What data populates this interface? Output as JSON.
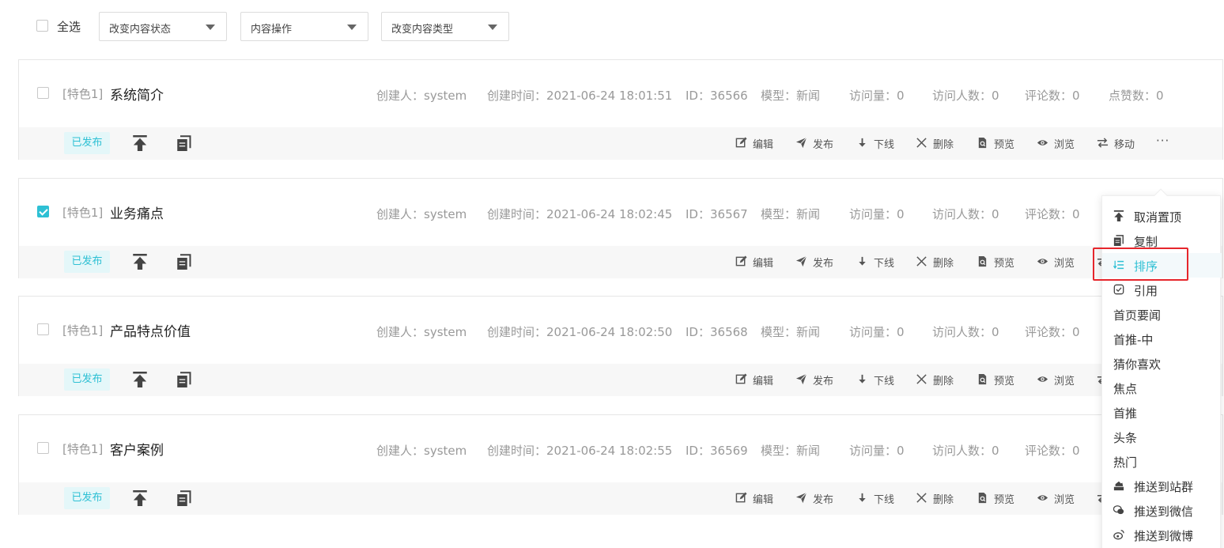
{
  "toolbar": {
    "select_all": "全选",
    "dropdowns": [
      "改变内容状态",
      "内容操作",
      "改变内容类型"
    ]
  },
  "labels": {
    "creator": "创建人：",
    "created_at": "创建时间：",
    "id": "ID：",
    "model": "模型：",
    "visits": "访问量：",
    "visitors": "访问人数：",
    "comments": "评论数：",
    "likes": "点赞数："
  },
  "actions": [
    "编辑",
    "发布",
    "下线",
    "删除",
    "预览",
    "浏览",
    "移动"
  ],
  "more": "···",
  "rows": [
    {
      "checked": false,
      "tag": "[特色1]",
      "title": "系统简介",
      "creator": "system",
      "created_at": "2021-06-24 18:01:51",
      "id": "36566",
      "model": "新闻",
      "visits": "0",
      "visitors": "0",
      "comments": "0",
      "likes": "0",
      "status": "已发布"
    },
    {
      "checked": true,
      "tag": "[特色1]",
      "title": "业务痛点",
      "creator": "system",
      "created_at": "2021-06-24 18:02:45",
      "id": "36567",
      "model": "新闻",
      "visits": "0",
      "visitors": "0",
      "comments": "0",
      "status": "已发布"
    },
    {
      "checked": false,
      "tag": "[特色1]",
      "title": "产品特点价值",
      "creator": "system",
      "created_at": "2021-06-24 18:02:50",
      "id": "36568",
      "model": "新闻",
      "visits": "0",
      "visitors": "0",
      "comments": "0",
      "status": "已发布"
    },
    {
      "checked": false,
      "tag": "[特色1]",
      "title": "客户案例",
      "creator": "system",
      "created_at": "2021-06-24 18:02:55",
      "id": "36569",
      "model": "新闻",
      "visits": "0",
      "visitors": "0",
      "comments": "0",
      "status": "已发布"
    }
  ],
  "menu": {
    "items": [
      {
        "label": "取消置顶",
        "icon": "arrow-up-icon"
      },
      {
        "label": "复制",
        "icon": "copy-icon"
      },
      {
        "label": "排序",
        "icon": "sort-icon",
        "active": true
      },
      {
        "label": "引用",
        "icon": "quote-icon"
      },
      {
        "label": "首页要闻"
      },
      {
        "label": "首推-中"
      },
      {
        "label": "猜你喜欢"
      },
      {
        "label": "焦点"
      },
      {
        "label": "首推"
      },
      {
        "label": "头条"
      },
      {
        "label": "热门"
      },
      {
        "label": "推送到站群",
        "icon": "site-group-icon"
      },
      {
        "label": "推送到微信",
        "icon": "wechat-icon"
      },
      {
        "label": "推送到微博",
        "icon": "weibo-icon"
      }
    ]
  },
  "colors": {
    "accent": "#2ec0d4",
    "highlight": "#e6262c"
  }
}
